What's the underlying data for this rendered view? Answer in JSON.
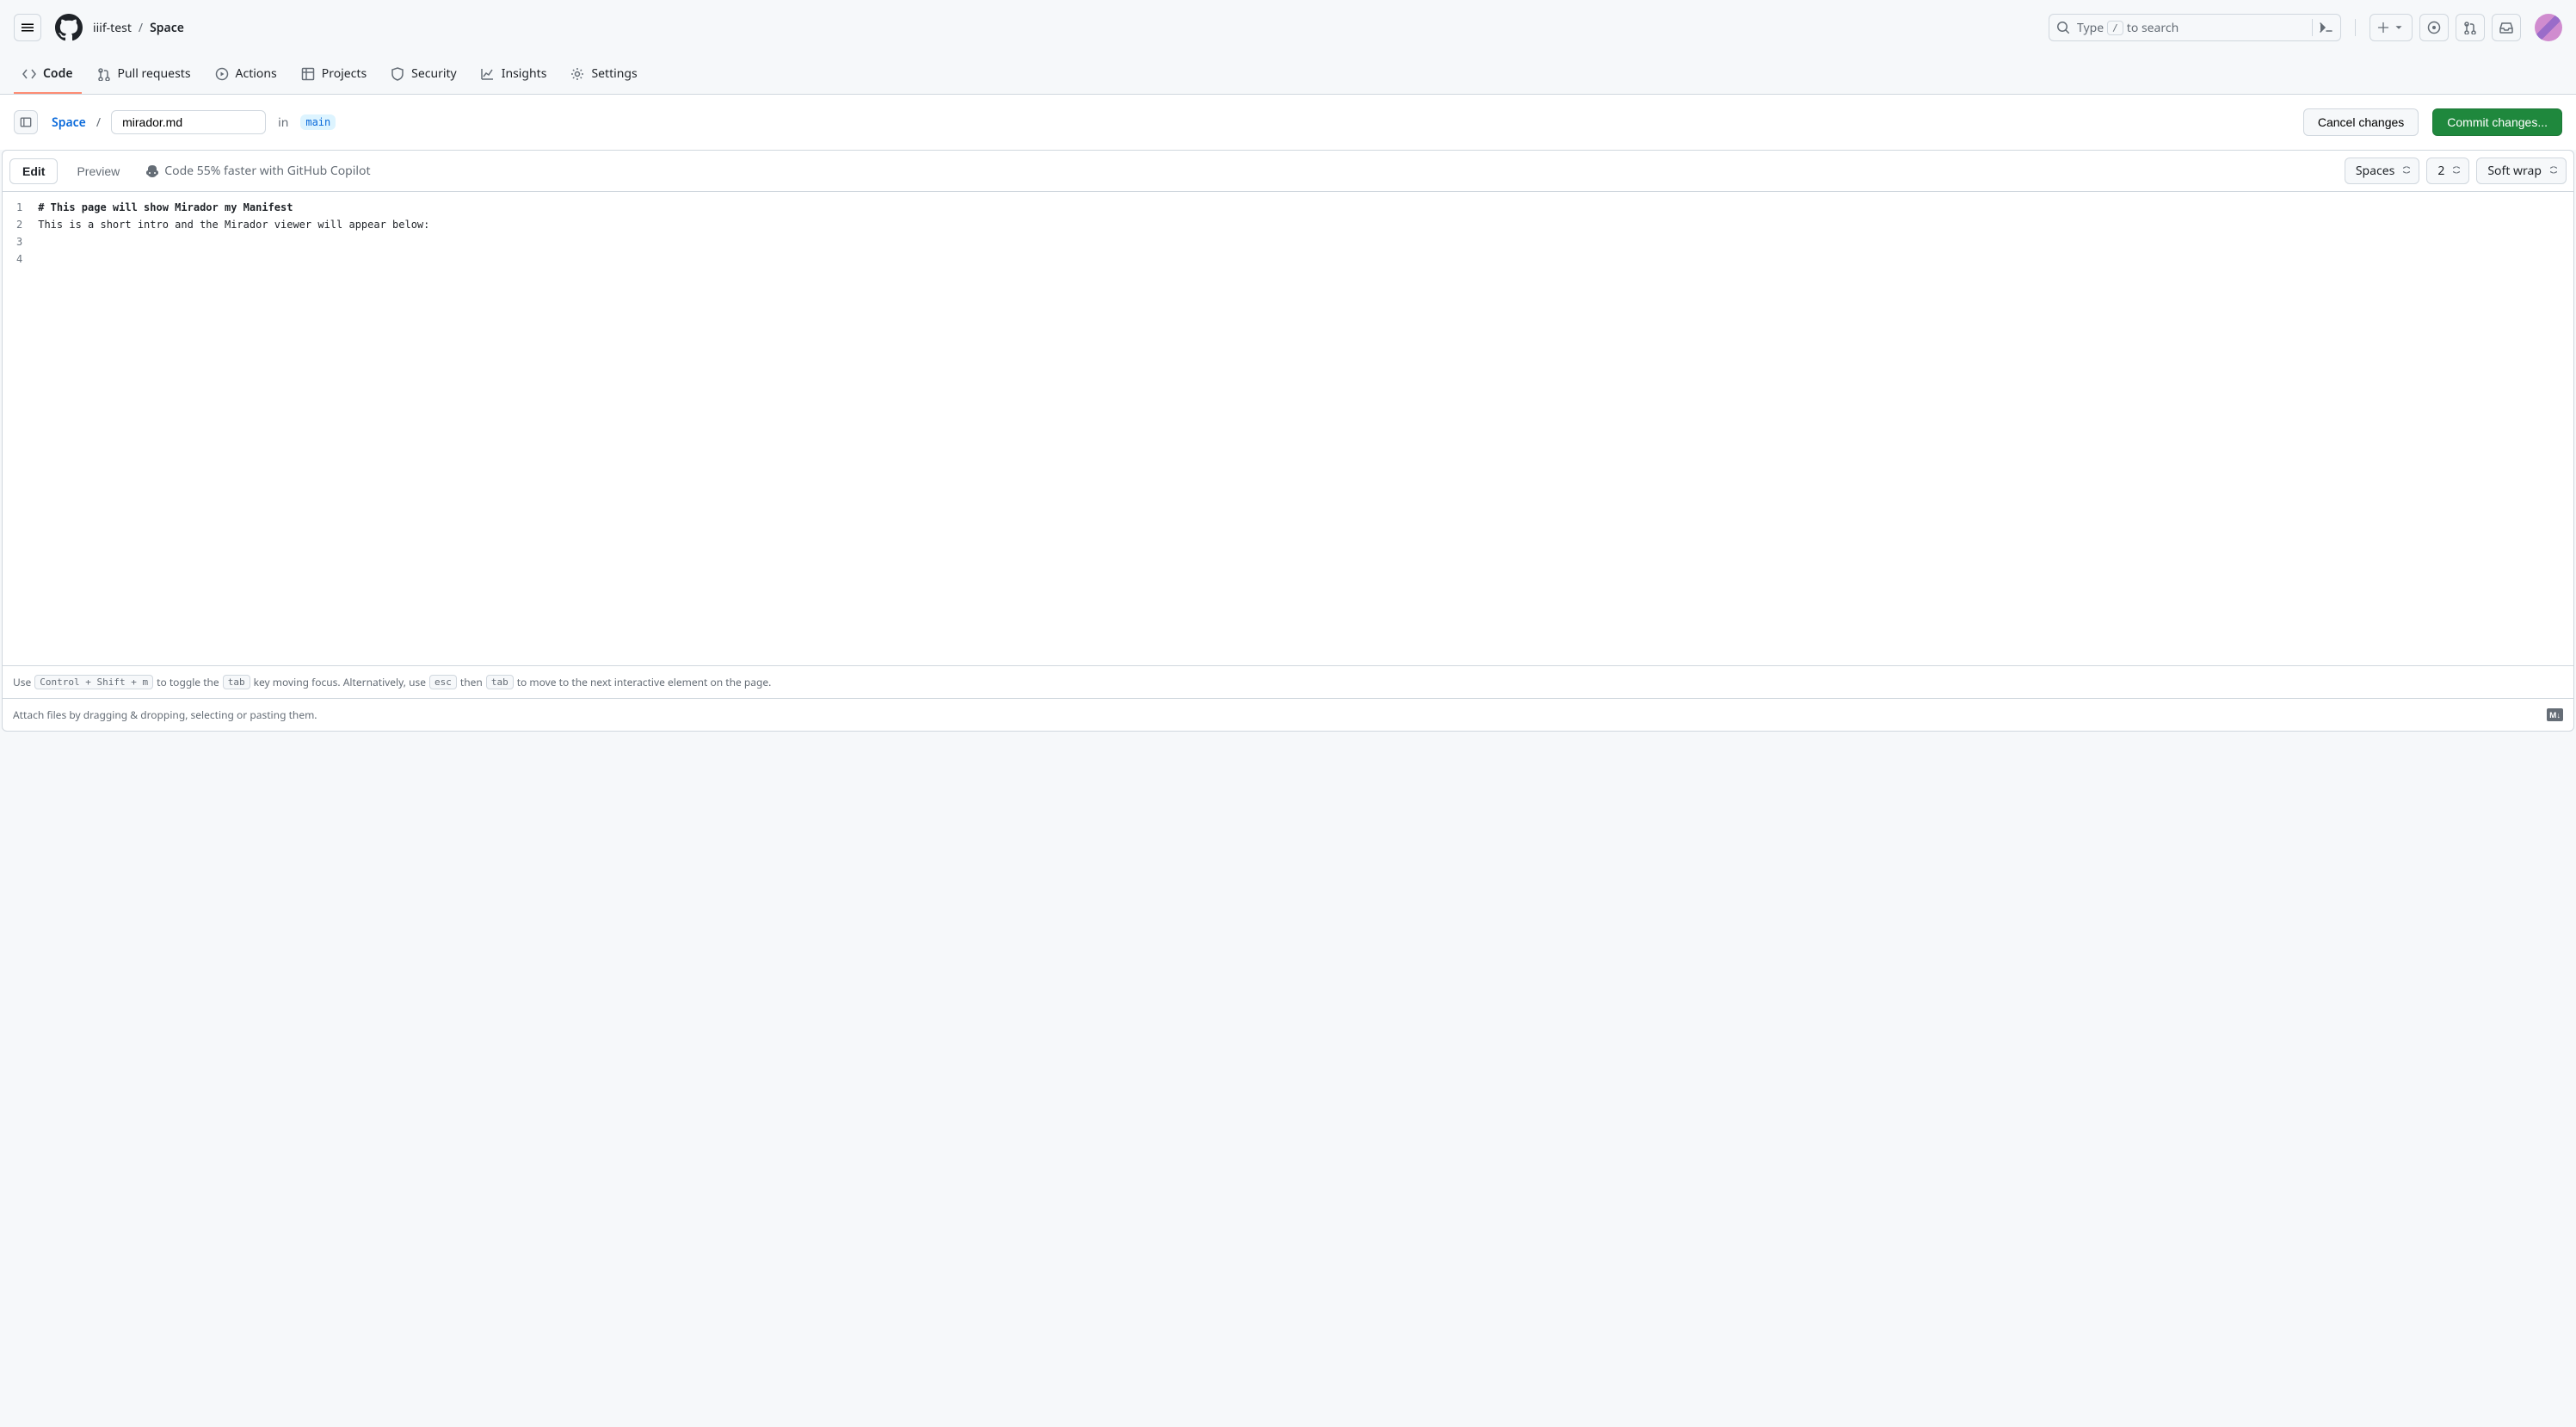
{
  "breadcrumb": {
    "owner": "iiif-test",
    "repo": "Space"
  },
  "search": {
    "prefix": "Type",
    "key": "/",
    "suffix": "to search"
  },
  "nav": {
    "code": "Code",
    "pull": "Pull requests",
    "actions": "Actions",
    "projects": "Projects",
    "security": "Security",
    "insights": "Insights",
    "settings": "Settings"
  },
  "fileHeader": {
    "repoLink": "Space",
    "filename": "mirador.md",
    "inText": "in",
    "branch": "main",
    "cancel": "Cancel changes",
    "commit": "Commit changes..."
  },
  "toolbar": {
    "edit": "Edit",
    "preview": "Preview",
    "copilot": "Code 55% faster with GitHub Copilot",
    "indentMode": "Spaces",
    "indentSize": "2",
    "wrap": "Soft wrap"
  },
  "editor": {
    "lineNumbers": [
      "1",
      "2",
      "3",
      "4"
    ],
    "lines": [
      "# This page will show Mirador my Manifest",
      "",
      "This is a short intro and the Mirador viewer will appear below:",
      ""
    ]
  },
  "hints": {
    "p1": "Use ",
    "k1": "Control + Shift + m",
    "p2": " to toggle the ",
    "k2": "tab",
    "p3": " key moving focus. Alternatively, use ",
    "k3": "esc",
    "p4": " then ",
    "k4": "tab",
    "p5": " to move to the next interactive element on the page."
  },
  "attach": {
    "text": "Attach files by dragging & dropping, selecting or pasting them.",
    "md": "M↓"
  }
}
